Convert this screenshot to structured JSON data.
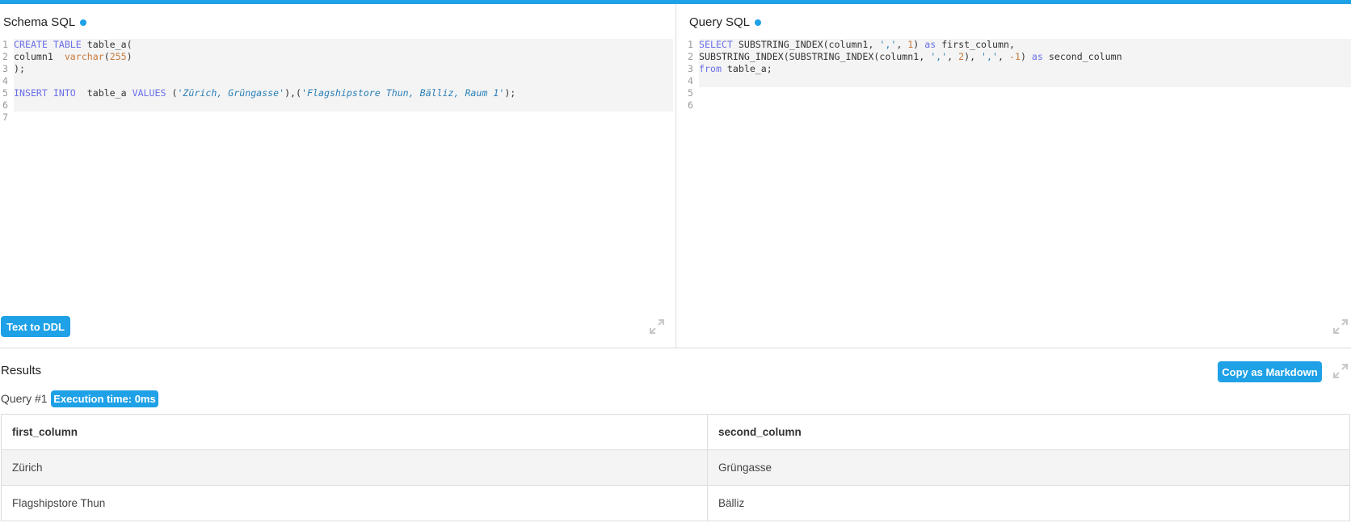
{
  "schema_panel": {
    "title": "Schema SQL",
    "lines": [
      {
        "n": "1",
        "tokens": [
          {
            "t": "CREATE TABLE",
            "c": "kw"
          },
          {
            "t": " table_a(",
            "c": ""
          }
        ]
      },
      {
        "n": "2",
        "tokens": [
          {
            "t": "column1  ",
            "c": ""
          },
          {
            "t": "varchar",
            "c": "num"
          },
          {
            "t": "(",
            "c": ""
          },
          {
            "t": "255",
            "c": "num"
          },
          {
            "t": ")",
            "c": ""
          }
        ]
      },
      {
        "n": "3",
        "tokens": [
          {
            "t": ");",
            "c": ""
          }
        ]
      },
      {
        "n": "4",
        "tokens": []
      },
      {
        "n": "5",
        "tokens": [
          {
            "t": "INSERT INTO",
            "c": "kw"
          },
          {
            "t": "  table_a ",
            "c": ""
          },
          {
            "t": "VALUES",
            "c": "kw"
          },
          {
            "t": " (",
            "c": ""
          },
          {
            "t": "'Zürich, Grüngasse'",
            "c": "str"
          },
          {
            "t": "),(",
            "c": ""
          },
          {
            "t": "'Flagshipstore Thun, Bälliz, Raum 1'",
            "c": "str"
          },
          {
            "t": ");",
            "c": ""
          }
        ]
      },
      {
        "n": "6",
        "tokens": []
      },
      {
        "n": "7",
        "tokens": []
      }
    ],
    "highlighted_lines": 6,
    "button_label": "Text to DDL"
  },
  "query_panel": {
    "title": "Query SQL",
    "lines": [
      {
        "n": "1",
        "tokens": [
          {
            "t": "SELECT",
            "c": "kw"
          },
          {
            "t": " SUBSTRING_INDEX(column1, ",
            "c": ""
          },
          {
            "t": "','",
            "c": "strq"
          },
          {
            "t": ", ",
            "c": ""
          },
          {
            "t": "1",
            "c": "num"
          },
          {
            "t": ") ",
            "c": ""
          },
          {
            "t": "as",
            "c": "kw"
          },
          {
            "t": " first_column,",
            "c": ""
          }
        ]
      },
      {
        "n": "2",
        "tokens": [
          {
            "t": "SUBSTRING_INDEX(SUBSTRING_INDEX(column1, ",
            "c": ""
          },
          {
            "t": "','",
            "c": "strq"
          },
          {
            "t": ", ",
            "c": ""
          },
          {
            "t": "2",
            "c": "num"
          },
          {
            "t": "), ",
            "c": ""
          },
          {
            "t": "','",
            "c": "strq"
          },
          {
            "t": ", ",
            "c": ""
          },
          {
            "t": "-1",
            "c": "num"
          },
          {
            "t": ") ",
            "c": ""
          },
          {
            "t": "as",
            "c": "kw"
          },
          {
            "t": " second_column",
            "c": ""
          }
        ]
      },
      {
        "n": "3",
        "tokens": [
          {
            "t": "from",
            "c": "kw"
          },
          {
            "t": " table_a;",
            "c": ""
          }
        ]
      },
      {
        "n": "4",
        "tokens": []
      },
      {
        "n": "5",
        "tokens": []
      },
      {
        "n": "6",
        "tokens": []
      }
    ],
    "highlighted_lines": 4
  },
  "results": {
    "title": "Results",
    "copy_button_label": "Copy as Markdown",
    "query_label": "Query #1",
    "execution_badge": "Execution time: 0ms",
    "columns": [
      "first_column",
      "second_column"
    ],
    "rows": [
      [
        "Zürich",
        "Grüngasse"
      ],
      [
        "Flagshipstore Thun",
        "Bälliz"
      ]
    ]
  },
  "icons": {
    "status_dot": "status-dot-icon",
    "expand": "expand-icon"
  },
  "colors": {
    "accent": "#1ea1e6",
    "keyword": "#6a6fe8",
    "number": "#c8793a",
    "string": "#2a7fb8"
  }
}
